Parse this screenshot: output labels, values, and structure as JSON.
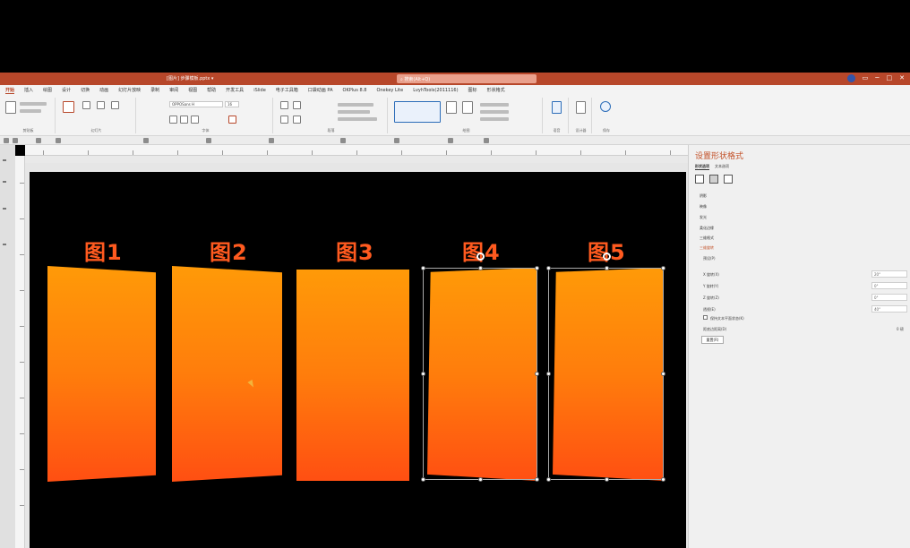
{
  "window": {
    "doc_title": "[图片] 步骤模板.pptx ▾",
    "search_placeholder": "搜索(Alt+Q)"
  },
  "tabs": [
    {
      "label": "开始",
      "active": true
    },
    {
      "label": "插入"
    },
    {
      "label": "绘图"
    },
    {
      "label": "设计"
    },
    {
      "label": "切换"
    },
    {
      "label": "动画"
    },
    {
      "label": "幻灯片放映"
    },
    {
      "label": "录制"
    },
    {
      "label": "审阅"
    },
    {
      "label": "视图"
    },
    {
      "label": "帮助"
    },
    {
      "label": "开发工具"
    },
    {
      "label": "iSlide"
    },
    {
      "label": "电子工具箱"
    },
    {
      "label": "口袋动画 PA"
    },
    {
      "label": "OKPlus 8.8"
    },
    {
      "label": "Onekey Lite"
    },
    {
      "label": "LvyhTools(2011116)"
    },
    {
      "label": "图标"
    },
    {
      "label": "形状格式"
    }
  ],
  "ribbon": {
    "groups": [
      "剪贴板",
      "幻灯片",
      "字体",
      "段落",
      "绘图",
      "语音",
      "设计器",
      "保存"
    ],
    "font_name": "OPPOSans H",
    "font_size": "16"
  },
  "slide": {
    "accent_color": "#ff5a1f",
    "gradient_top": "#ff9a08",
    "gradient_bottom": "#ff4f12",
    "panels": [
      {
        "label": "图1"
      },
      {
        "label": "图2"
      },
      {
        "label": "图3"
      },
      {
        "label": "图4"
      },
      {
        "label": "图5"
      }
    ]
  },
  "format_pane": {
    "title": "设置形状格式",
    "tabs": [
      "形状选项",
      "文本选项"
    ],
    "effect_items": [
      "阴影",
      "映像",
      "发光",
      "柔化边缘",
      "三维格式",
      "三维旋转"
    ],
    "preset_label": "预设(P)",
    "x_label": "X 旋转(X)",
    "y_label": "Y 旋转(Y)",
    "z_label": "Z 旋转(Z)",
    "perspective_label": "透视(E)",
    "x_value": "20°",
    "y_value": "0°",
    "z_value": "0°",
    "perspective_value": "40°",
    "keep_text_flat": "保持文本平面状态(K)",
    "distance_label": "距底边距离(D)",
    "distance_value": "0 磅",
    "reset_button": "重置(R)"
  }
}
